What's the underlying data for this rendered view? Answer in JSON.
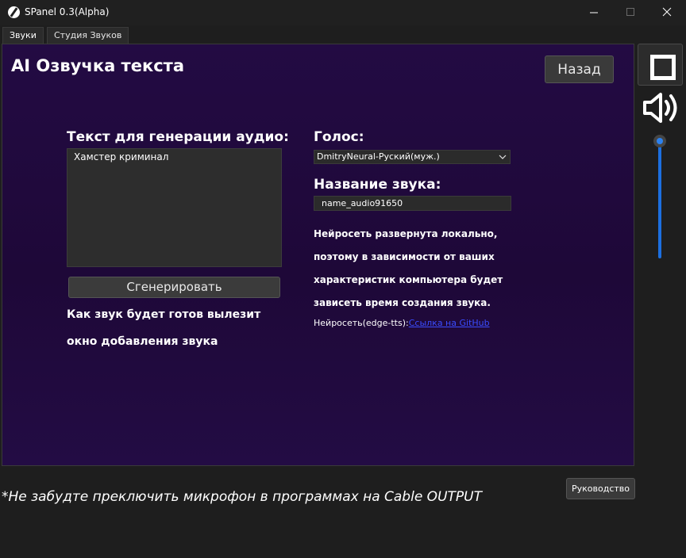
{
  "window": {
    "title": "SPanel 0.3(Alpha)"
  },
  "tabs": [
    {
      "label": "Звуки",
      "active": true
    },
    {
      "label": "Студия Звуков",
      "active": false
    }
  ],
  "main": {
    "page_title": "AI Озвучка текста",
    "back_button": "Назад",
    "text_label": "Текст для генерации аудио:",
    "text_value": "Хамстер криминал",
    "generate_button": "Сгенерировать",
    "hint_line1": "Как звук будет готов вылезит",
    "hint_line2": "окно добавления звука",
    "voice_label": "Голос:",
    "voice_selected": "DmitryNeural-Руский(муж.)",
    "sound_name_label": "Название звука:",
    "sound_name_value": "name_audio91650",
    "info_lines": [
      "Нейросеть развернута локально,",
      "поэтому в зависимости от ваших",
      "характеристик компьютера будет",
      "зависеть время создания звука."
    ],
    "source_prefix": "Нейросеть(edge-tts):",
    "source_link": "Ссылка на GitHub"
  },
  "sidebar": {
    "volume_level": 0.0,
    "accent_color": "#1c6fe0"
  },
  "footer": {
    "warning": "*Не забудте преключить микрофон в программах на Cable OUTPUT",
    "manual_button": "Руководство"
  },
  "icons": [
    "app-logo-icon",
    "minimize-icon",
    "maximize-icon",
    "close-icon",
    "stop-square-icon",
    "speaker-volume-icon",
    "chevron-down-icon"
  ]
}
